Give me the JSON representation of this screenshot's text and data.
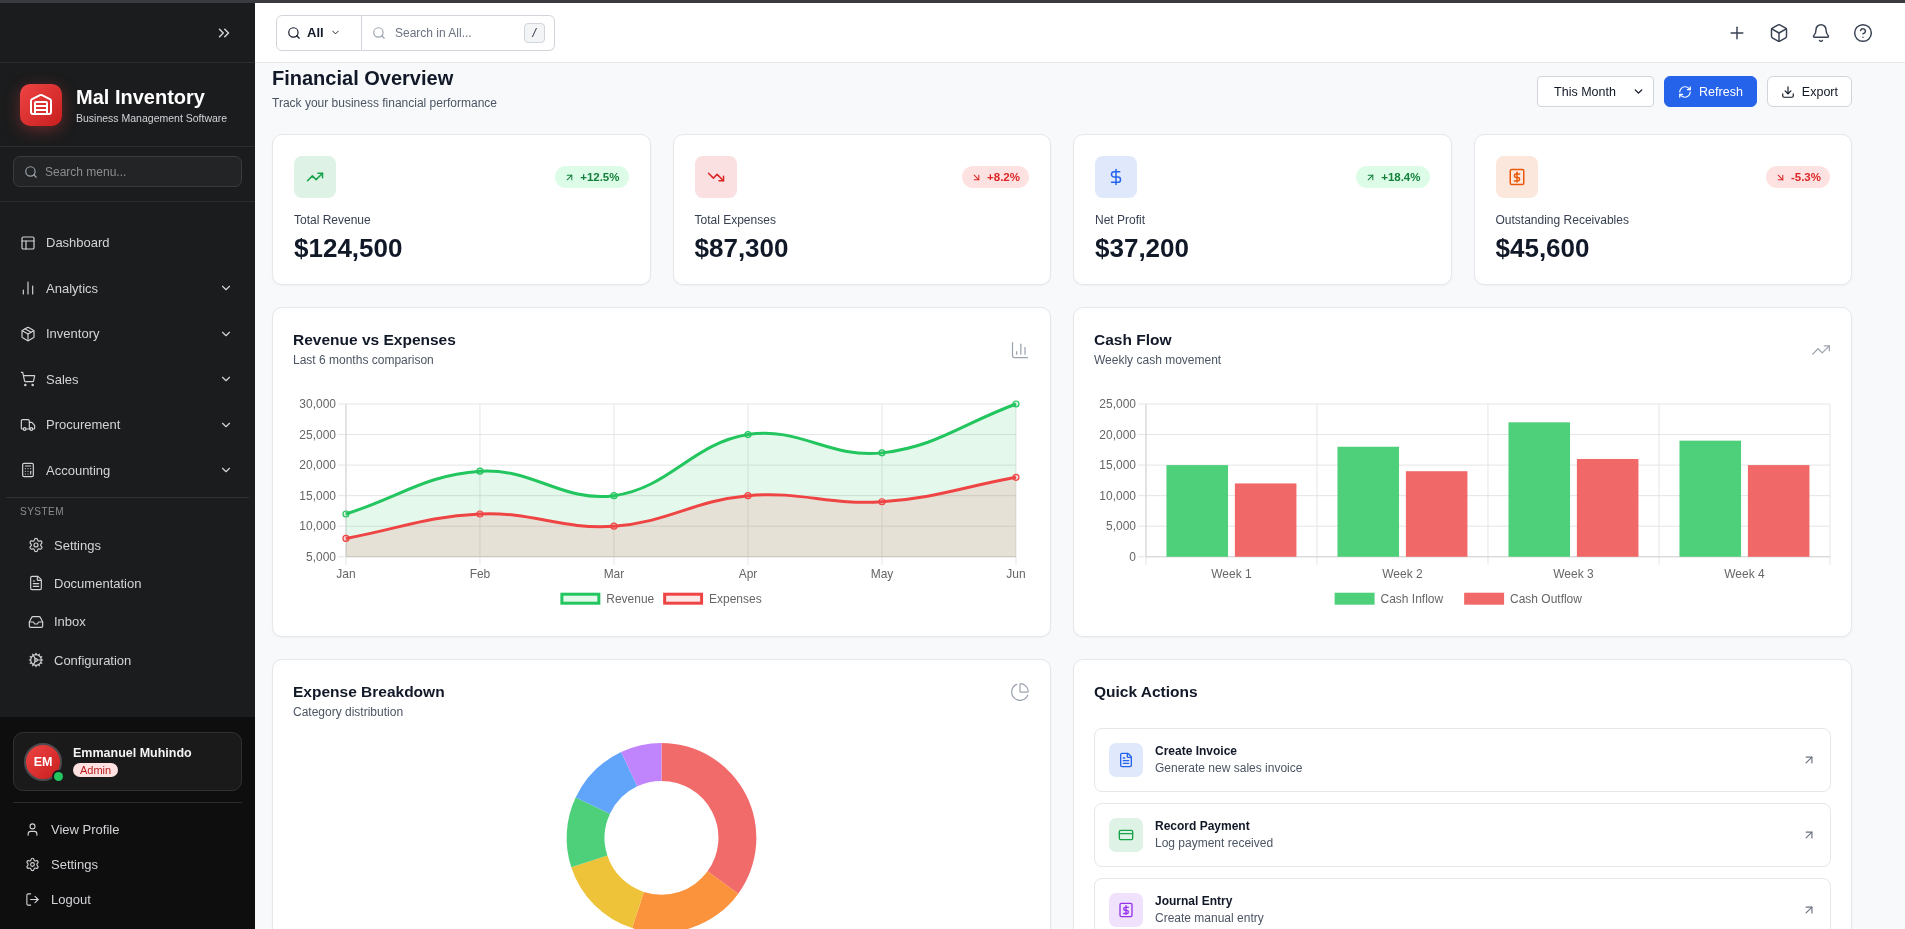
{
  "sidebar": {
    "brand": {
      "name": "Mal Inventory",
      "tagline": "Business Management Software"
    },
    "search": {
      "placeholder": "Search menu..."
    },
    "nav": [
      {
        "label": "Dashboard",
        "kind": "link",
        "selected": false
      },
      {
        "label": "Analytics",
        "kind": "group",
        "selected": false
      },
      {
        "label": "Inventory",
        "kind": "group",
        "selected": false
      },
      {
        "label": "Sales",
        "kind": "group",
        "selected": false
      },
      {
        "label": "Procurement",
        "kind": "group",
        "selected": false
      },
      {
        "label": "Accounting",
        "kind": "group",
        "selected": false
      }
    ],
    "section_label": "SYSTEM",
    "system_nav": [
      {
        "label": "Settings",
        "selected": false
      },
      {
        "label": "Documentation",
        "selected": false
      },
      {
        "label": "Inbox",
        "selected": false
      },
      {
        "label": "Configuration",
        "selected": false
      }
    ],
    "user": {
      "initials": "EM",
      "name": "Emmanuel Muhindo",
      "role": "Admin",
      "online": true
    },
    "user_menu": [
      "View Profile",
      "Settings",
      "Logout"
    ]
  },
  "topbar": {
    "scope": "All",
    "search_placeholder": "Search in All...",
    "shortcut": "/"
  },
  "header": {
    "title": "Financial Overview",
    "subtitle": "Track your business financial performance",
    "period": "This Month",
    "buttons": [
      {
        "label": "Refresh",
        "kind": "primary"
      },
      {
        "label": "Export",
        "kind": "secondary"
      }
    ]
  },
  "stats": [
    {
      "label": "Total Revenue",
      "value": "$124,500",
      "change": "+12.5%",
      "kind": "up",
      "color": "#16a34a"
    },
    {
      "label": "Total Expenses",
      "value": "$87,300",
      "change": "+8.2%",
      "kind": "down",
      "color": "#dc2626"
    },
    {
      "label": "Net Profit",
      "value": "$37,200",
      "change": "+18.4%",
      "kind": "up",
      "color": "#2563eb"
    },
    {
      "label": "Outstanding Receivables",
      "value": "$45,600",
      "change": "-5.3%",
      "kind": "down",
      "color": "#ea580c"
    }
  ],
  "revenue_chart": {
    "title": "Revenue vs Expenses",
    "subtitle": "Last 6 months comparison",
    "chart_data": {
      "type": "area",
      "categories": [
        "Jan",
        "Feb",
        "Mar",
        "Apr",
        "May",
        "Jun"
      ],
      "series": [
        {
          "name": "Revenue",
          "color": "#22c55e",
          "values": [
            12000,
            19000,
            15000,
            25000,
            22000,
            30000
          ]
        },
        {
          "name": "Expenses",
          "color": "#ef4444",
          "values": [
            8000,
            12000,
            10000,
            15000,
            14000,
            18000
          ]
        }
      ],
      "ylim": [
        5000,
        30000
      ],
      "yticks": [
        {
          "value": 5000,
          "label": "5,000"
        },
        {
          "value": 10000,
          "label": "10,000"
        },
        {
          "value": 15000,
          "label": "15,000"
        },
        {
          "value": 20000,
          "label": "20,000"
        },
        {
          "value": 25000,
          "label": "25,000"
        },
        {
          "value": 30000,
          "label": "30,000"
        }
      ],
      "grid": true,
      "legend": "bottom"
    }
  },
  "cash_flow": {
    "title": "Cash Flow",
    "subtitle": "Weekly cash movement",
    "chart_data": {
      "type": "bar",
      "categories": [
        "Week 1",
        "Week 2",
        "Week 3",
        "Week 4"
      ],
      "series": [
        {
          "name": "Cash Inflow",
          "color": "#4ecf7a",
          "values": [
            15000,
            18000,
            22000,
            19000
          ]
        },
        {
          "name": "Cash Outflow",
          "color": "#f06868",
          "values": [
            12000,
            14000,
            16000,
            15000
          ]
        }
      ],
      "ylim": [
        0,
        25000
      ],
      "yticks": [
        {
          "value": 0,
          "label": "0"
        },
        {
          "value": 5000,
          "label": "5,000"
        },
        {
          "value": 10000,
          "label": "10,000"
        },
        {
          "value": 15000,
          "label": "15,000"
        },
        {
          "value": 20000,
          "label": "20,000"
        },
        {
          "value": 25000,
          "label": "25,000"
        }
      ],
      "grid": true,
      "legend": "bottom"
    }
  },
  "expense_breakdown": {
    "title": "Expense Breakdown",
    "subtitle": "Category distribution"
  },
  "quick_actions": {
    "title": "Quick Actions",
    "items": [
      {
        "title": "Create Invoice",
        "subtitle": "Generate new sales invoice",
        "color": "#2563eb"
      },
      {
        "title": "Record Payment",
        "subtitle": "Log payment received",
        "color": "#16a34a"
      },
      {
        "title": "Journal Entry",
        "subtitle": "Create manual entry",
        "color": "#9333ea"
      }
    ]
  }
}
